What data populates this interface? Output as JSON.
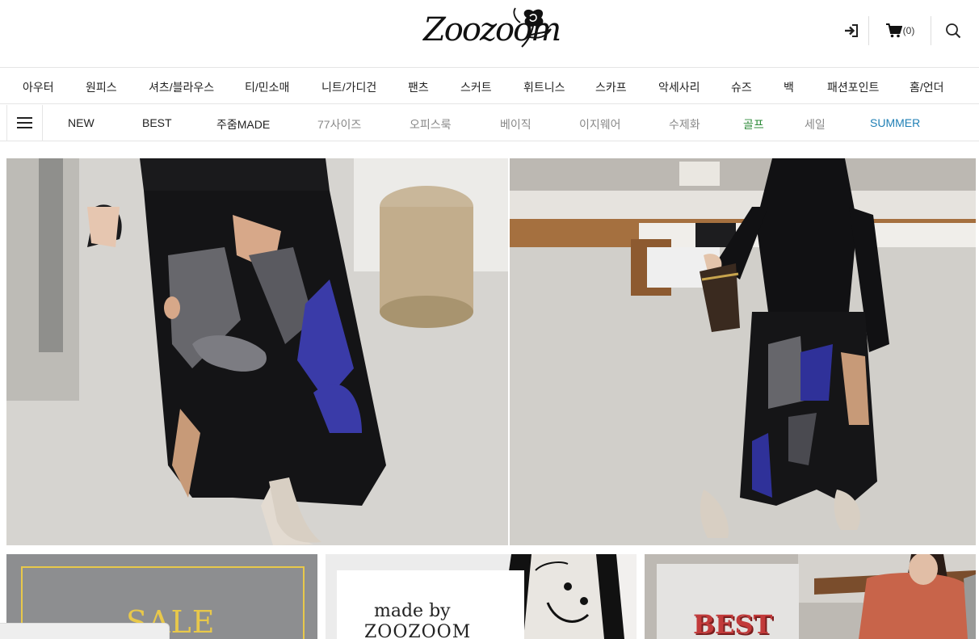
{
  "brand": {
    "logo_text": "Zoozoom"
  },
  "header": {
    "cart_count": "(0)",
    "icons": {
      "login": "login-icon",
      "cart": "cart-icon",
      "search": "search-icon"
    }
  },
  "category_nav": [
    "아우터",
    "원피스",
    "셔츠/블라우스",
    "티/민소매",
    "니트/가디건",
    "팬츠",
    "스커트",
    "휘트니스",
    "스카프",
    "악세사리",
    "슈즈",
    "백",
    "패션포인트",
    "홈/언더"
  ],
  "sub_nav": [
    {
      "label": "NEW",
      "color": "#222222"
    },
    {
      "label": "BEST",
      "color": "#222222"
    },
    {
      "label": "주줌MADE",
      "color": "#222222"
    },
    {
      "label": "77사이즈",
      "color": "#888888"
    },
    {
      "label": "오피스룩",
      "color": "#888888"
    },
    {
      "label": "베이직",
      "color": "#888888"
    },
    {
      "label": "이지웨어",
      "color": "#888888"
    },
    {
      "label": "수제화",
      "color": "#888888"
    },
    {
      "label": "골프",
      "color": "#2e8b3a"
    },
    {
      "label": "세일",
      "color": "#888888"
    },
    {
      "label": "SUMMER",
      "color": "#1f7fb5"
    }
  ],
  "tiles": {
    "sale": "SALE",
    "made_line1": "made by",
    "made_line2": "ZOOZOOM",
    "best": "BEST"
  },
  "colors": {
    "accent_gold": "#e8c84a",
    "best_red": "#c23a3a"
  }
}
